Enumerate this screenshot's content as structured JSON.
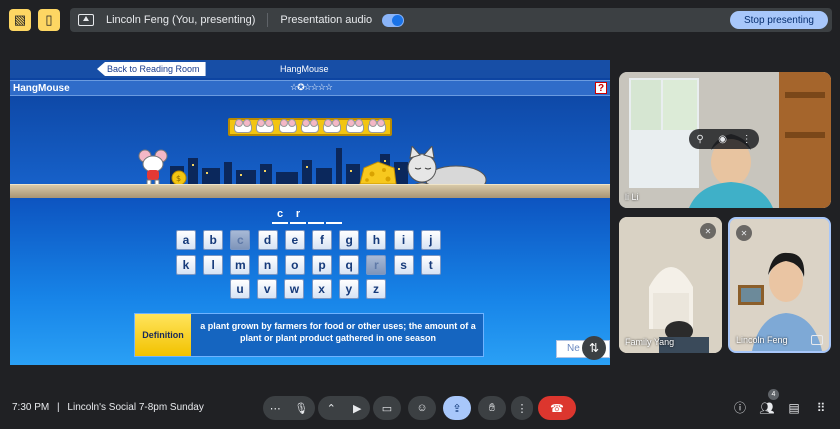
{
  "topbar": {
    "presenter_label": "Lincoln Feng (You, presenting)",
    "audio_label": "Presentation audio",
    "stop_label": "Stop presenting"
  },
  "game": {
    "back_label": "Back to Reading Room",
    "top_title": "HangMouse",
    "name": "HangMouse",
    "stars": "☆✪☆☆☆☆",
    "help_label": "?",
    "word_slots": [
      "c",
      "r",
      "",
      ""
    ],
    "keyboard_rows": [
      [
        "a",
        "b",
        "c",
        "d",
        "e",
        "f",
        "g",
        "h",
        "i",
        "j"
      ],
      [
        "k",
        "l",
        "m",
        "n",
        "o",
        "p",
        "q",
        "r",
        "s",
        "t"
      ],
      [
        "u",
        "v",
        "w",
        "x",
        "y",
        "z"
      ]
    ],
    "used_letters": [
      "c",
      "r"
    ],
    "definition_label": "Definition",
    "definition_text": "a plant grown by farmers for food or other uses; the amount of a plant or plant product gathered in one season",
    "next_label": "Ne"
  },
  "participants": [
    {
      "name": "li Li"
    },
    {
      "name": "Family Yang"
    },
    {
      "name": "Lincoln Feng"
    }
  ],
  "bottombar": {
    "time": "7:30 PM",
    "separator": "|",
    "meeting_name": "Lincoln's Social 7-8pm Sunday",
    "people_count": "4"
  },
  "colors": {
    "accent": "#a8c7fa",
    "hangup": "#dc362e",
    "highlight": "#fdd663"
  }
}
